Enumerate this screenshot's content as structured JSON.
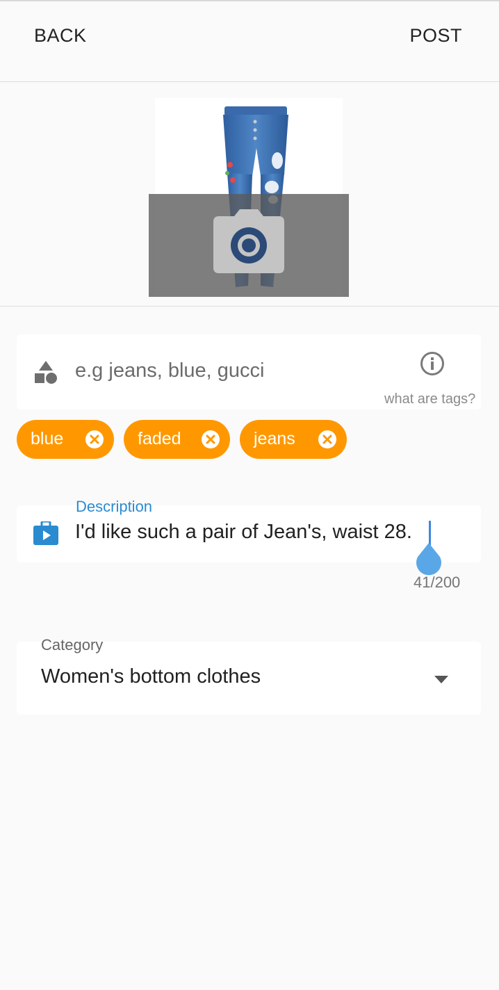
{
  "appbar": {
    "back_label": "BACK",
    "post_label": "POST"
  },
  "photo": {
    "icon": "camera-icon",
    "overlay_color": "#5a5a5a"
  },
  "tags": {
    "placeholder": "e.g jeans, blue, gucci",
    "help_text": "what are tags?",
    "chip_color": "#ff9800",
    "chips": [
      {
        "label": "blue"
      },
      {
        "label": "faded"
      },
      {
        "label": "jeans"
      }
    ]
  },
  "description": {
    "label": "Description",
    "value": "I'd like such a pair of Jean's, waist 28.",
    "counter": "41/200",
    "accent_color": "#2a8bd0"
  },
  "category": {
    "label": "Category",
    "value": "Women's bottom clothes"
  }
}
